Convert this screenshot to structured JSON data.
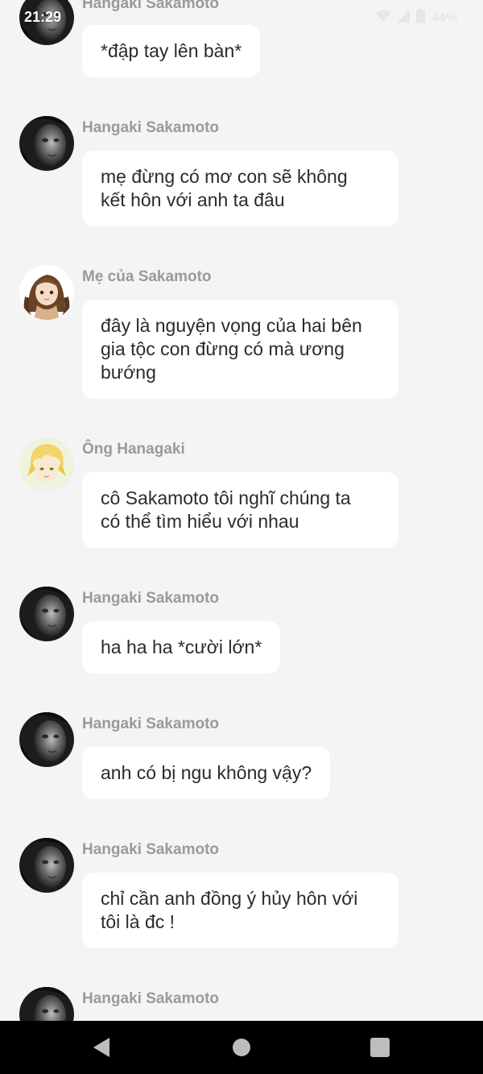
{
  "status_bar": {
    "time": "21:29",
    "battery": "44%",
    "icons": [
      "wifi-icon",
      "cell-signal-icon",
      "battery-icon"
    ]
  },
  "messages": [
    {
      "sender": "Hangaki Sakamoto",
      "avatar": "woman-bw-portrait",
      "text": "*đập tay lên bàn*"
    },
    {
      "sender": "Hangaki Sakamoto",
      "avatar": "woman-bw-portrait",
      "text": "mẹ đừng có mơ con sẽ không\nkết hôn với anh ta đâu"
    },
    {
      "sender": "Mẹ của Sakamoto",
      "avatar": "anime-girl-brown-hair",
      "text": "đây là nguyện vọng của hai bên\ngia tộc con đừng có mà ương\nbướng"
    },
    {
      "sender": "Ông Hanagaki",
      "avatar": "anime-boy-blonde",
      "text": "cô Sakamoto tôi nghĩ chúng ta\ncó thể tìm hiểu với nhau"
    },
    {
      "sender": "Hangaki Sakamoto",
      "avatar": "woman-bw-portrait",
      "text": "ha ha ha *cười lớn*"
    },
    {
      "sender": "Hangaki Sakamoto",
      "avatar": "woman-bw-portrait",
      "text": "anh có bị ngu không vậy?"
    },
    {
      "sender": "Hangaki Sakamoto",
      "avatar": "woman-bw-portrait",
      "text": "chỉ cần anh đồng ý hủy hôn với\ntôi là đc !"
    },
    {
      "sender": "Hangaki Sakamoto",
      "avatar": "woman-bw-portrait",
      "text": ""
    }
  ],
  "nav_bar": {
    "buttons": [
      "back-icon",
      "home-icon",
      "recents-icon"
    ]
  },
  "colors": {
    "background": "#f4f4f4",
    "bubble": "#ffffff",
    "sender_text": "#9a9a9a",
    "message_text": "#2b2b2b",
    "nav_bar": "#000000"
  }
}
